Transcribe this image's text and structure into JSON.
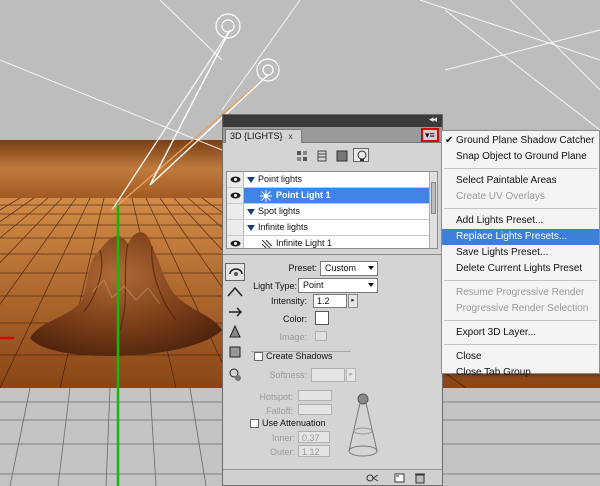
{
  "panel": {
    "title": "3D {LIGHTS}",
    "collapse_glyph": "◂◂",
    "close_glyph": "x",
    "menu_glyph": "▾≡",
    "filters": [
      "whole-scene-icon",
      "meshes-icon",
      "materials-icon",
      "lights-icon"
    ],
    "light_list": [
      {
        "label": "Point lights",
        "type": "group",
        "selected": false
      },
      {
        "label": "Point Light 1",
        "type": "item",
        "selected": true
      },
      {
        "label": "Spot lights",
        "type": "group",
        "selected": false
      },
      {
        "label": "Infinite lights",
        "type": "group",
        "selected": false
      },
      {
        "label": "Infinite Light 1",
        "type": "item",
        "selected": false
      }
    ],
    "properties": {
      "preset_label": "Preset:",
      "preset_value": "Custom",
      "light_type_label": "Light Type:",
      "light_type_value": "Point",
      "intensity_label": "Intensity:",
      "intensity_value": "1.2",
      "color_label": "Color:",
      "image_label": "Image:",
      "create_shadows_label": "Create Shadows",
      "softness_label": "Softness:",
      "hotspot_label": "Hotspot:",
      "falloff_label": "Falloff:",
      "use_attenuation_label": "Use Attenuation",
      "inner_label": "Inner:",
      "inner_value": "0.37",
      "outer_label": "Outer:",
      "outer_value": "1.12",
      "spin_glyph": "▸"
    }
  },
  "menu": {
    "groups": [
      [
        {
          "label": "Ground Plane Shadow Catcher",
          "checked": true,
          "enabled": true
        },
        {
          "label": "Snap Object to Ground Plane",
          "checked": false,
          "enabled": true
        }
      ],
      [
        {
          "label": "Select Paintable Areas",
          "checked": false,
          "enabled": true
        },
        {
          "label": "Create UV Overlays",
          "checked": false,
          "enabled": false
        }
      ],
      [
        {
          "label": "Add Lights Preset...",
          "checked": false,
          "enabled": true
        },
        {
          "label": "Replace Lights Presets...",
          "checked": false,
          "enabled": true,
          "highlighted": true
        },
        {
          "label": "Save Lights Preset...",
          "checked": false,
          "enabled": true
        },
        {
          "label": "Delete Current Lights Preset",
          "checked": false,
          "enabled": true
        }
      ],
      [
        {
          "label": "Resume Progressive Render",
          "checked": false,
          "enabled": false
        },
        {
          "label": "Progressive Render Selection",
          "checked": false,
          "enabled": false
        }
      ],
      [
        {
          "label": "Export 3D Layer...",
          "checked": false,
          "enabled": true
        }
      ],
      [
        {
          "label": "Close",
          "checked": false,
          "enabled": true
        },
        {
          "label": "Close Tab Group",
          "checked": false,
          "enabled": true
        }
      ]
    ],
    "check_glyph": "✔"
  },
  "colors": {
    "highlight": "#3e7fd9",
    "selected_row": "#3f85e6",
    "menu_button_outline": "#e00000",
    "axis_green": "#00c400",
    "axis_red": "#e00000",
    "floor_orange": "#b86a2e"
  }
}
